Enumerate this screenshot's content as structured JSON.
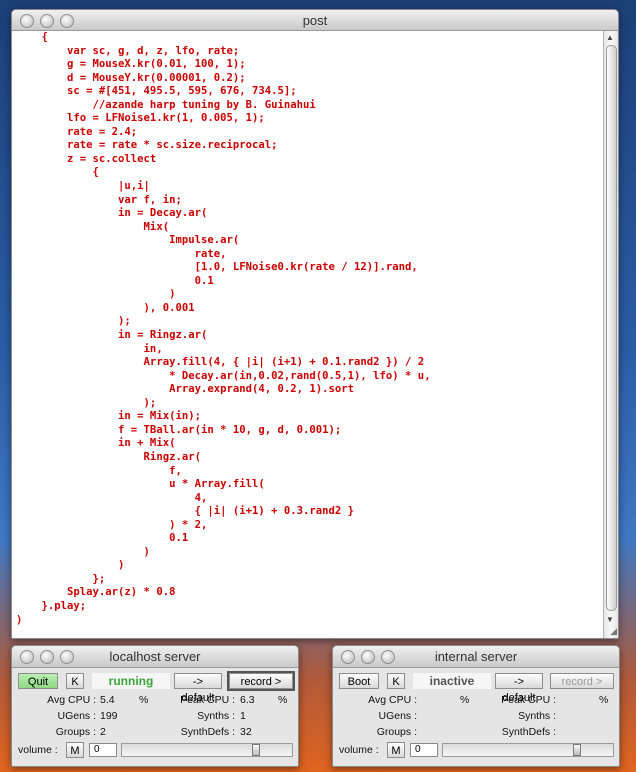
{
  "post_window": {
    "title": "post",
    "code_lines": [
      "    {",
      "        var sc, g, d, z, lfo, rate;",
      "        g = MouseX.kr(0.01, 100, 1);",
      "        d = MouseY.kr(0.00001, 0.2);",
      "        sc = #[451, 495.5, 595, 676, 734.5];",
      "            //azande harp tuning by B. Guinahui",
      "        lfo = LFNoise1.kr(1, 0.005, 1);",
      "        rate = 2.4;",
      "        rate = rate * sc.size.reciprocal;",
      "        z = sc.collect",
      "            {",
      "                |u,i|",
      "                var f, in;",
      "                in = Decay.ar(",
      "                    Mix(",
      "                        Impulse.ar(",
      "                            rate,",
      "                            [1.0, LFNoise0.kr(rate / 12)].rand,",
      "                            0.1",
      "                        )",
      "                    ), 0.001",
      "                );",
      "                in = Ringz.ar(",
      "                    in,",
      "                    Array.fill(4, { |i| (i+1) + 0.1.rand2 }) / 2",
      "                        * Decay.ar(in,0.02,rand(0.5,1), lfo) * u,",
      "                        Array.exprand(4, 0.2, 1).sort",
      "                    );",
      "                in = Mix(in);",
      "                f = TBall.ar(in * 10, g, d, 0.001);",
      "                in + Mix(",
      "                    Ringz.ar(",
      "                        f,",
      "                        u * Array.fill(",
      "                            4,",
      "                            { |i| (i+1) + 0.3.rand2 }",
      "                        ) * 2,",
      "                        0.1",
      "                    )",
      "                )",
      "            };",
      "        Splay.ar(z) * 0.8",
      "    }.play;",
      ")"
    ]
  },
  "localhost": {
    "title": "localhost server",
    "quit_label": "Quit",
    "k_label": "K",
    "status": "running",
    "default_label": "-> default",
    "record_label": "record >",
    "avg_cpu_label": "Avg CPU :",
    "avg_cpu_value": "5.4",
    "pct1": "%",
    "peak_cpu_label": "Peak CPU :",
    "peak_cpu_value": "6.3",
    "pct2": "%",
    "ugens_label": "UGens :",
    "ugens_value": "199",
    "synths_label": "Synths :",
    "synths_value": "1",
    "groups_label": "Groups :",
    "groups_value": "2",
    "synthdefs_label": "SynthDefs :",
    "synthdefs_value": "32",
    "volume_label": "volume :",
    "mute_label": "M",
    "volume_value": "0",
    "volume_level": 0.8
  },
  "internal": {
    "title": "internal server",
    "boot_label": "Boot",
    "k_label": "K",
    "status": "inactive",
    "default_label": "-> default",
    "record_label": "record >",
    "avg_cpu_label": "Avg CPU :",
    "pct1": "%",
    "peak_cpu_label": "Peak CPU :",
    "pct2": "%",
    "ugens_label": "UGens :",
    "synths_label": "Synths :",
    "groups_label": "Groups :",
    "synthdefs_label": "SynthDefs :",
    "volume_label": "volume :",
    "mute_label": "M",
    "volume_value": "0",
    "volume_level": 0.8
  },
  "colors": {
    "code": "#cc0000",
    "running": "#3aa53a"
  }
}
